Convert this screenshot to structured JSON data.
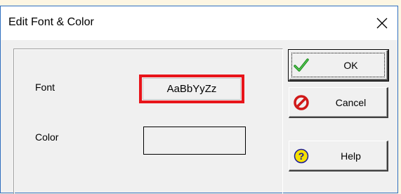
{
  "dialog": {
    "title": "Edit Font & Color",
    "close_glyph": "✕"
  },
  "fields": {
    "font_label": "Font",
    "font_sample": "AaBbYyZz",
    "color_label": "Color"
  },
  "buttons": {
    "ok": {
      "label": "OK",
      "icon": "checkmark-icon"
    },
    "cancel": {
      "label": "Cancel",
      "icon": "cancel-icon"
    },
    "help": {
      "label": "Help",
      "icon": "help-icon"
    }
  },
  "colors": {
    "highlight_border": "#e8141a",
    "window_border": "#2f6fbf",
    "dialog_bg": "#f0f0f0"
  }
}
